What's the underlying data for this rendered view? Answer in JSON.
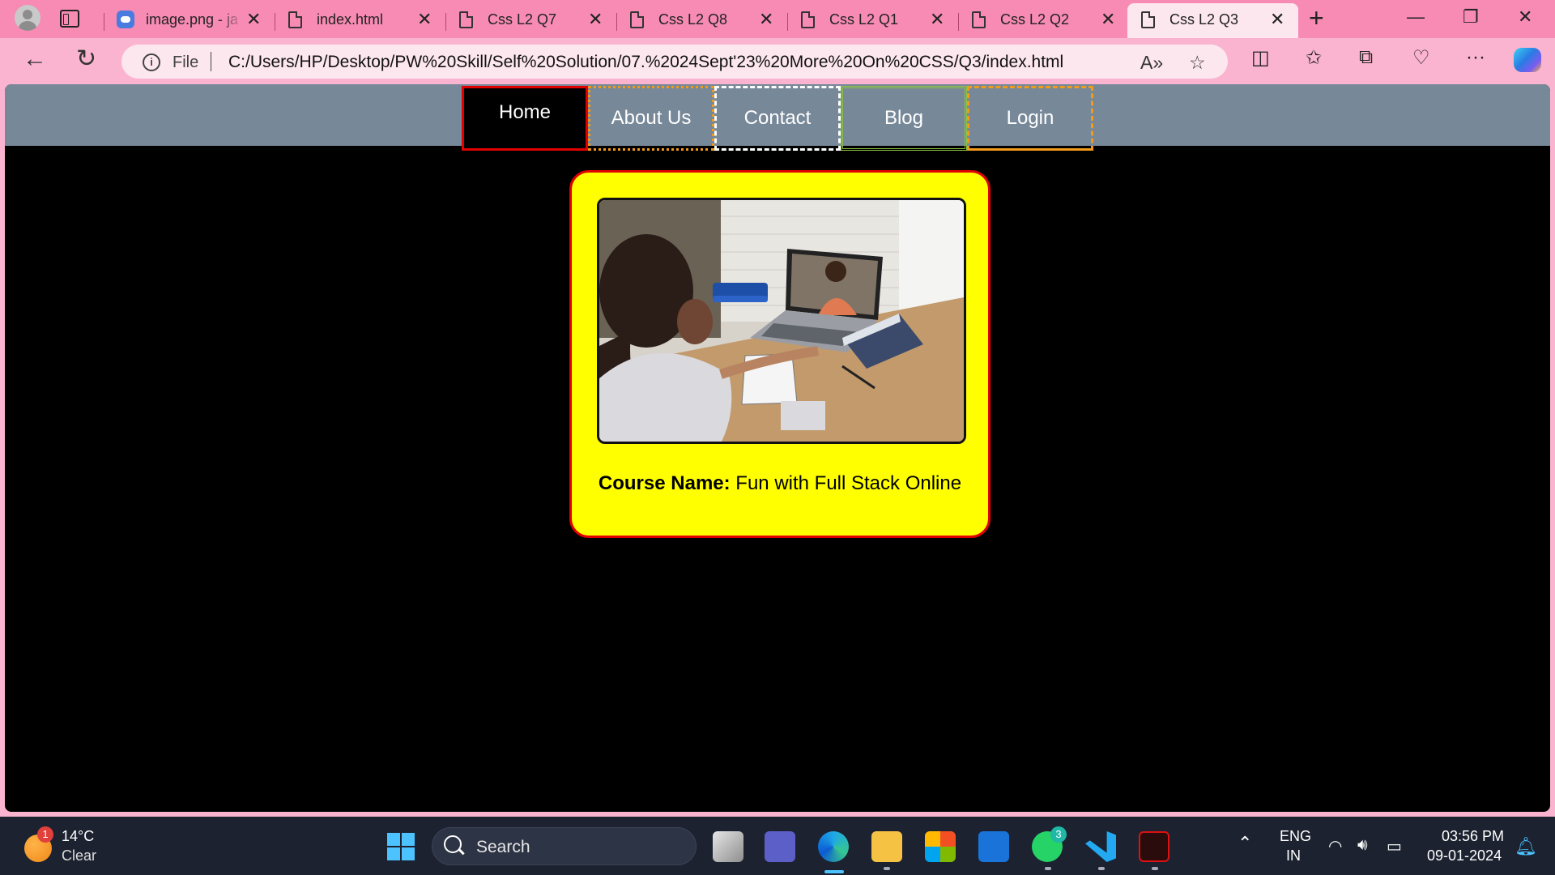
{
  "browser": {
    "tabs": [
      {
        "title": "image.png - ja",
        "close": "✕"
      },
      {
        "title": "index.html",
        "close": "✕"
      },
      {
        "title": "Css L2 Q7",
        "close": "✕"
      },
      {
        "title": "Css L2 Q8",
        "close": "✕"
      },
      {
        "title": "Css L2 Q1",
        "close": "✕"
      },
      {
        "title": "Css L2 Q2",
        "close": "✕"
      },
      {
        "title": "Css L2 Q3",
        "close": "✕",
        "active": true
      }
    ],
    "new_tab": "+",
    "address": {
      "scheme_label": "File",
      "url": "C:/Users/HP/Desktop/PW%20Skill/Self%20Solution/07.%2024Sept'23%20More%20On%20CSS/Q3/index.html"
    }
  },
  "page": {
    "nav": {
      "home": "Home",
      "about": "About Us",
      "contact": "Contact",
      "blog": "Blog",
      "login": "Login"
    },
    "card": {
      "course_label": "Course Name:",
      "course_value": " Fun with Full Stack Online"
    },
    "colors": {
      "navbar_bg": "#778899",
      "page_bg": "#000000",
      "card_bg": "#ffff00",
      "card_border": "#e10000"
    }
  },
  "taskbar": {
    "weather_badge": "1",
    "temperature": "14°C",
    "condition": "Clear",
    "search_placeholder": "Search",
    "whatsapp_badge": "3",
    "language_line1": "ENG",
    "language_line2": "IN",
    "time": "03:56 PM",
    "date": "09-01-2024"
  }
}
